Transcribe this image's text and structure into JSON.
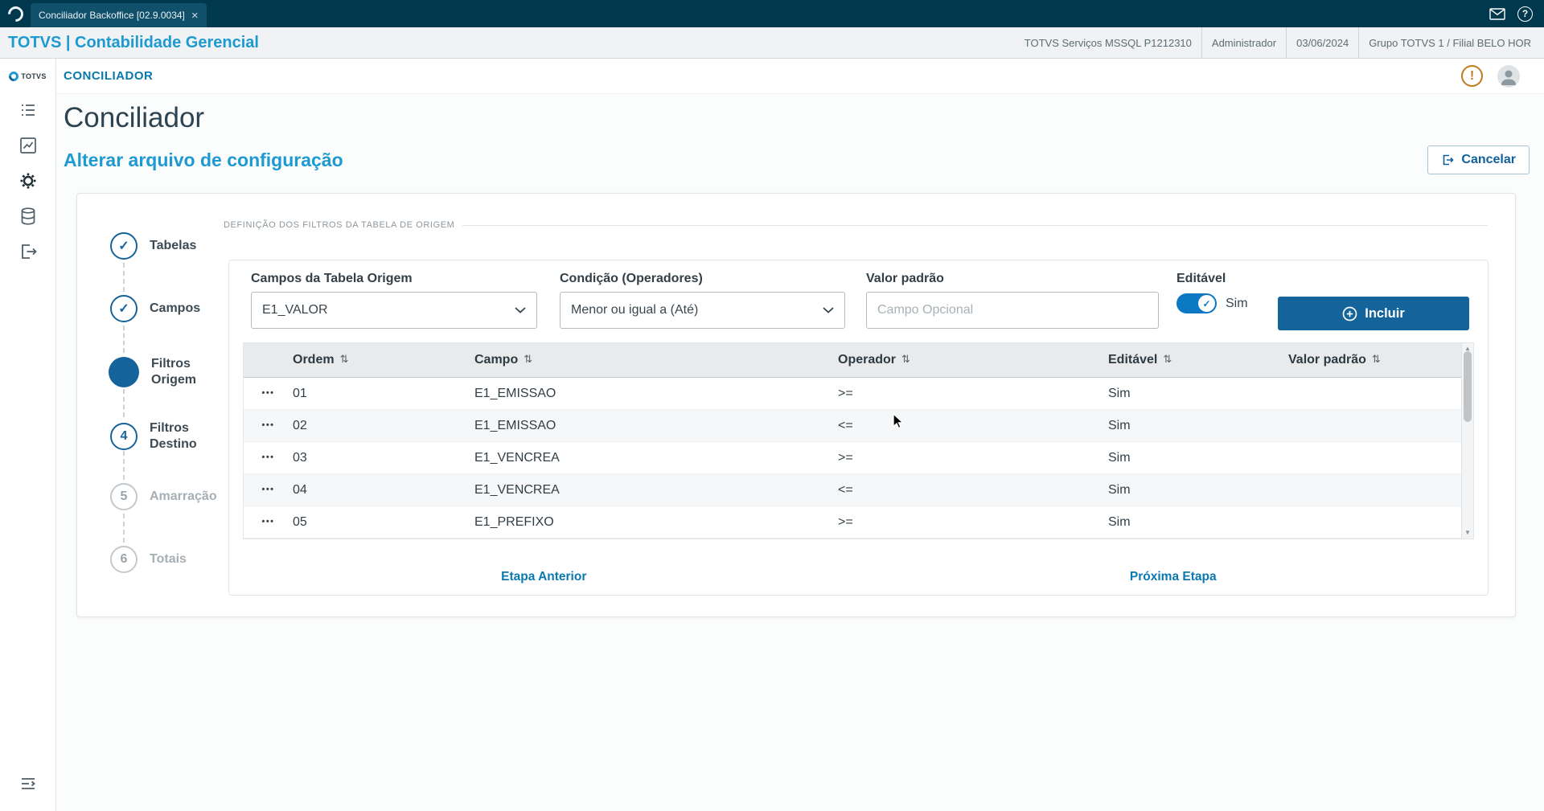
{
  "topbar": {
    "tab_title": "Conciliador Backoffice [02.9.0034]"
  },
  "header": {
    "brand": "TOTVS | Contabilidade Gerencial",
    "info": [
      "TOTVS Serviços MSSQL P1212310",
      "Administrador",
      "03/06/2024",
      "Grupo TOTVS 1 / Filial BELO HOR"
    ]
  },
  "sidebar": {
    "logo_text": "TOTVS"
  },
  "appbar": {
    "title": "CONCILIADOR"
  },
  "page": {
    "title": "Conciliador",
    "subtitle": "Alterar arquivo de configuração",
    "cancel_button": "Cancelar"
  },
  "stepper": [
    {
      "label": "Tabelas",
      "symbol": "✓",
      "state": "done"
    },
    {
      "label": "Campos",
      "symbol": "✓",
      "state": "done"
    },
    {
      "label": "Filtros Origem",
      "symbol": "",
      "state": "active"
    },
    {
      "label": "Filtros Destino",
      "symbol": "4",
      "state": "next"
    },
    {
      "label": "Amarração",
      "symbol": "5",
      "state": "upcoming"
    },
    {
      "label": "Totais",
      "symbol": "6",
      "state": "upcoming"
    }
  ],
  "form": {
    "section_title": "DEFINIÇÃO DOS FILTROS DA TABELA DE ORIGEM",
    "origin_field": {
      "label": "Campos da Tabela Origem",
      "value": "E1_VALOR"
    },
    "condition_field": {
      "label": "Condição (Operadores)",
      "value": "Menor ou igual a (Até)"
    },
    "default_value_field": {
      "label": "Valor padrão",
      "placeholder": "Campo Opcional"
    },
    "editable_field": {
      "label": "Editável",
      "value": "Sim"
    },
    "include_button": "Incluir"
  },
  "table": {
    "columns": [
      "Ordem",
      "Campo",
      "Operador",
      "Editável",
      "Valor padrão"
    ],
    "rows": [
      {
        "ordem": "01",
        "campo": "E1_EMISSAO",
        "operador": ">=",
        "editavel": "Sim",
        "valor_padrao": ""
      },
      {
        "ordem": "02",
        "campo": "E1_EMISSAO",
        "operador": "<=",
        "editavel": "Sim",
        "valor_padrao": ""
      },
      {
        "ordem": "03",
        "campo": "E1_VENCREA",
        "operador": ">=",
        "editavel": "Sim",
        "valor_padrao": ""
      },
      {
        "ordem": "04",
        "campo": "E1_VENCREA",
        "operador": "<=",
        "editavel": "Sim",
        "valor_padrao": ""
      },
      {
        "ordem": "05",
        "campo": "E1_PREFIXO",
        "operador": ">=",
        "editavel": "Sim",
        "valor_padrao": ""
      }
    ]
  },
  "wizard_nav": {
    "previous": "Etapa Anterior",
    "next": "Próxima Etapa"
  },
  "icons": {
    "close": "×",
    "help": "?",
    "warning": "!",
    "sort": "⇅",
    "row_actions": "•••",
    "toggle_check": "✓",
    "scroll_up": "▲",
    "scroll_down": "▼"
  },
  "colors": {
    "topbar_bg": "#00384d",
    "brand_blue": "#1d9ad2",
    "primary_blue": "#15639b",
    "link_blue": "#0b78b0",
    "warning_orange": "#c07a20"
  }
}
